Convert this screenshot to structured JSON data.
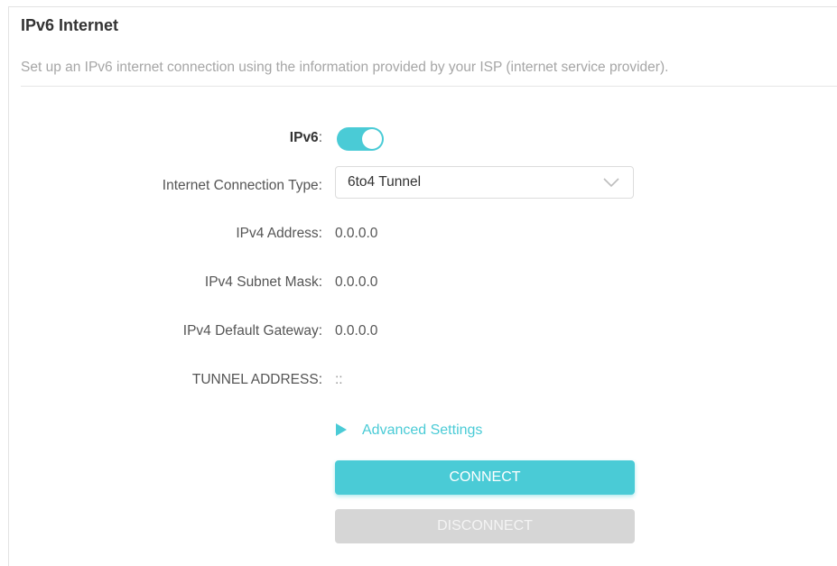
{
  "header": {
    "title": "IPv6 Internet",
    "description": "Set up an IPv6 internet connection using the information provided by your ISP (internet service provider)."
  },
  "form": {
    "ipv6": {
      "label": "IPv6",
      "enabled": true
    },
    "connection_type": {
      "label": "Internet Connection Type:",
      "value": "6to4 Tunnel"
    },
    "ipv4_address": {
      "label": "IPv4 Address:",
      "value": "0.0.0.0"
    },
    "ipv4_subnet_mask": {
      "label": "IPv4 Subnet Mask:",
      "value": "0.0.0.0"
    },
    "ipv4_default_gateway": {
      "label": "IPv4 Default Gateway:",
      "value": "0.0.0.0"
    },
    "tunnel_address": {
      "label": "TUNNEL ADDRESS:",
      "value": "::"
    }
  },
  "advanced": {
    "label": "Advanced Settings"
  },
  "buttons": {
    "connect": "CONNECT",
    "disconnect": "DISCONNECT"
  },
  "colors": {
    "accent": "#4acbd6",
    "disabled": "#d6d6d6"
  }
}
